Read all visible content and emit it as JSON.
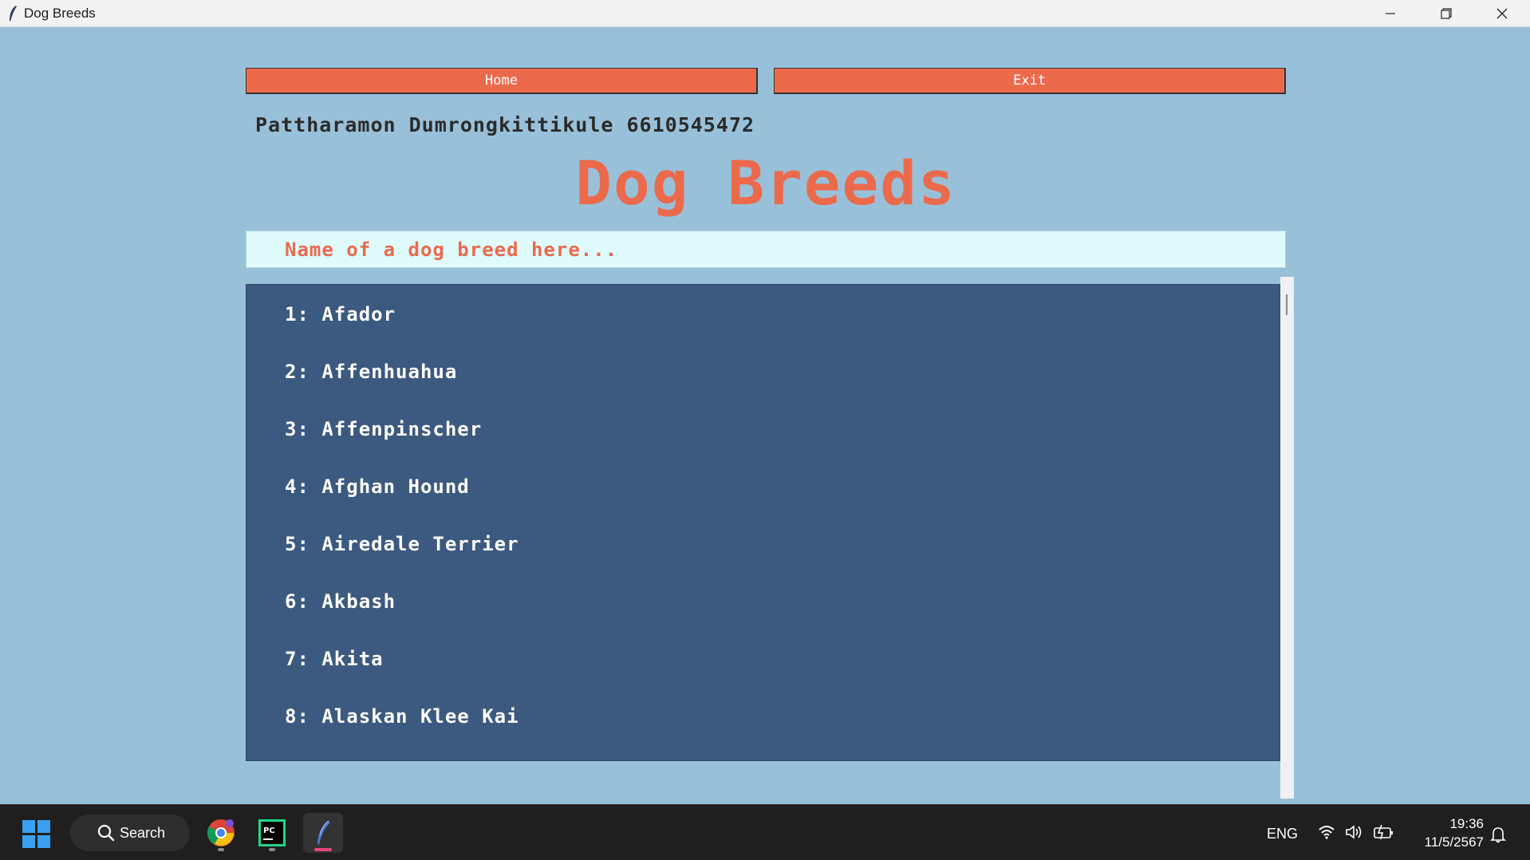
{
  "window": {
    "title": "Dog Breeds"
  },
  "toolbar": {
    "home_label": "Home",
    "exit_label": "Exit"
  },
  "header": {
    "student": "Pattharamon Dumrongkittikule 6610545472",
    "title": "Dog Breeds"
  },
  "search": {
    "placeholder": "Name of a dog breed here..."
  },
  "breeds": [
    {
      "label": "1: Afador"
    },
    {
      "label": "2: Affenhuahua"
    },
    {
      "label": "3: Affenpinscher"
    },
    {
      "label": "4: Afghan Hound"
    },
    {
      "label": "5: Airedale Terrier"
    },
    {
      "label": "6: Akbash"
    },
    {
      "label": "7: Akita"
    },
    {
      "label": "8: Alaskan Klee Kai"
    }
  ],
  "taskbar": {
    "search_label": "Search",
    "language": "ENG",
    "time": "19:36",
    "date": "11/5/2567",
    "apps": [
      "chrome-icon",
      "pycharm-icon",
      "python-feather-icon"
    ]
  },
  "colors": {
    "accent": "#ec6a4c",
    "background": "#99c0d9",
    "list_bg": "#3c5a80",
    "search_bg": "#dffbfc"
  }
}
